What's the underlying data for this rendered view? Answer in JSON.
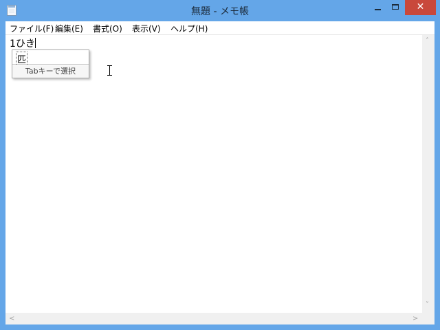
{
  "window": {
    "title": "無題 - メモ帳"
  },
  "controls": {
    "close_glyph": "✕"
  },
  "menu": {
    "items": [
      {
        "label": "ファイル(F)"
      },
      {
        "label": "編集(E)"
      },
      {
        "label": "書式(O)"
      },
      {
        "label": "表示(V)"
      },
      {
        "label": "ヘルプ(H)"
      }
    ]
  },
  "editor": {
    "committed_text": "1",
    "composing_text": "ひき"
  },
  "ime": {
    "candidate": "匹",
    "hint": "Tabキーで選択"
  },
  "scrollbars": {
    "up_arrow": "˄",
    "down_arrow": "˅",
    "left_arrow": "<",
    "right_arrow": ">"
  },
  "colors": {
    "frame": "#64a6e8",
    "close_button": "#c9483b"
  }
}
